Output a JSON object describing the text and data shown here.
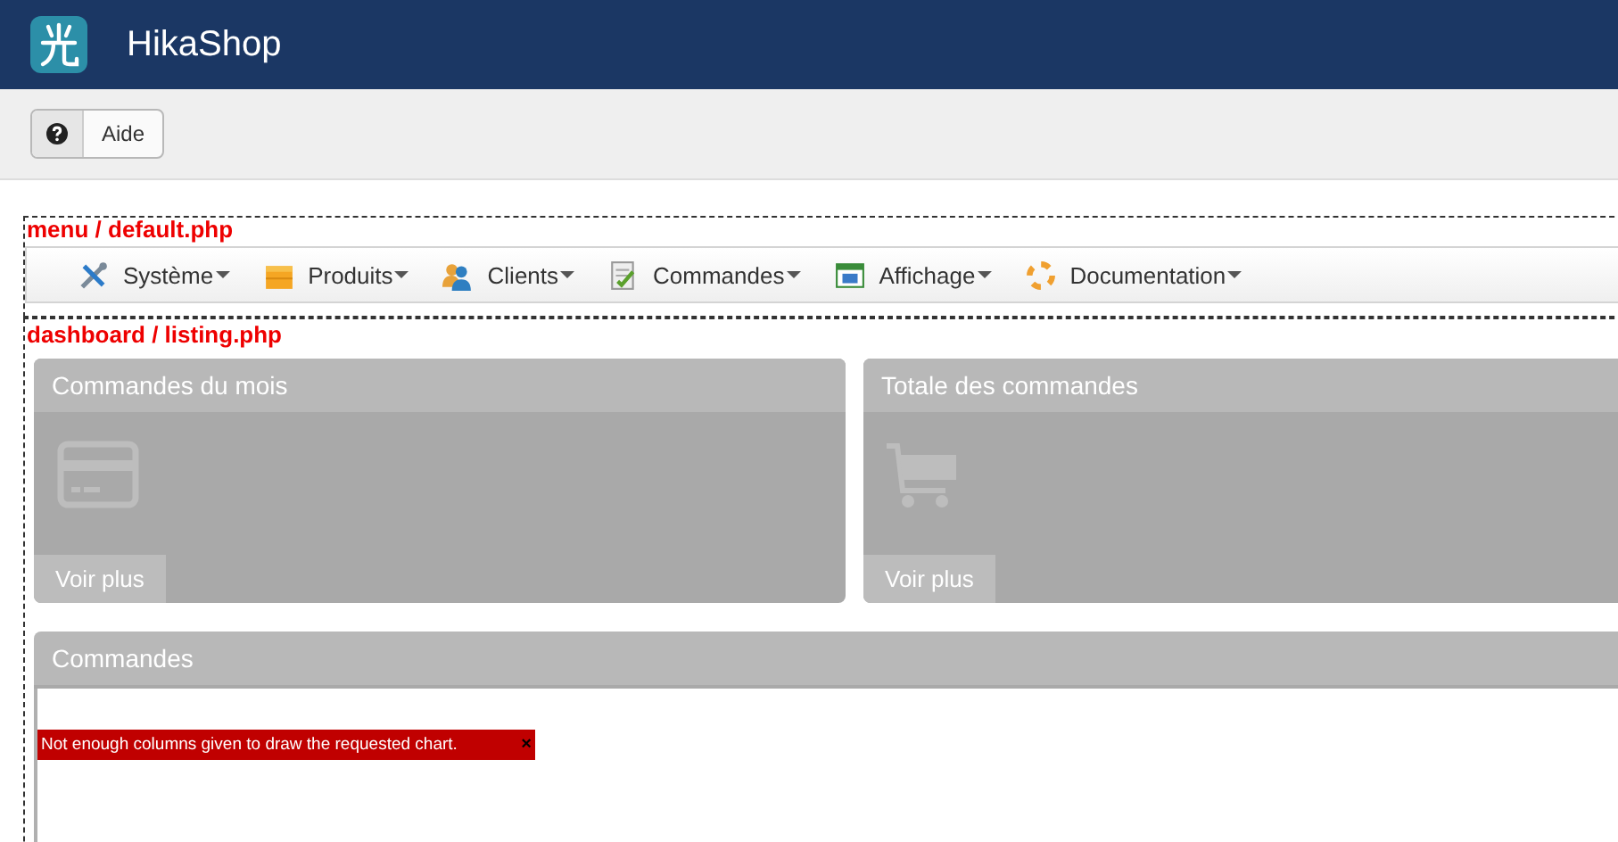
{
  "header": {
    "title": "HikaShop"
  },
  "toolbar": {
    "buttons": [
      {
        "label": "Aide"
      }
    ]
  },
  "menu_section": {
    "label": "menu / default.php",
    "items": [
      {
        "label": "Système"
      },
      {
        "label": "Produits"
      },
      {
        "label": "Clients"
      },
      {
        "label": "Commandes"
      },
      {
        "label": "Affichage"
      },
      {
        "label": "Documentation"
      }
    ]
  },
  "dashboard_section": {
    "label": "dashboard / listing.php",
    "cards": [
      {
        "title": "Commandes du mois",
        "link": "Voir plus"
      },
      {
        "title": "Totale des commandes",
        "link": "Voir plus"
      }
    ],
    "panel": {
      "title": "Commandes",
      "error": "Not enough columns given to draw the requested chart.",
      "close": "×"
    }
  }
}
